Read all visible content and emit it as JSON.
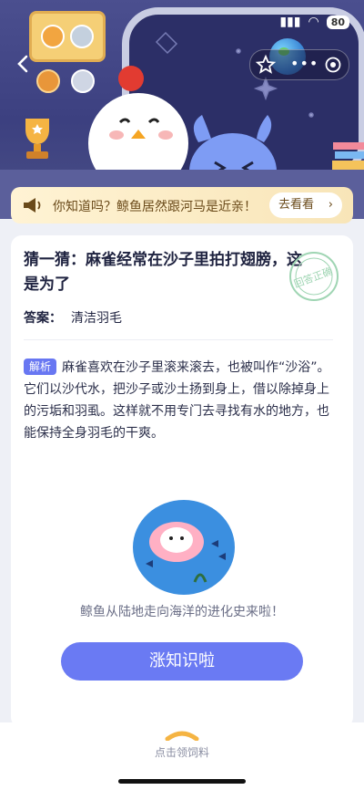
{
  "status_bar": {
    "battery": "80"
  },
  "notice": {
    "text": "你知道吗？鲸鱼居然跟河马是近亲！",
    "button_label": "去看看",
    "button_chevron": "›"
  },
  "question": {
    "title": "猜一猜：麻雀经常在沙子里拍打翅膀，这是为了",
    "stamp_text": "回答正确"
  },
  "answer": {
    "label": "答案：",
    "value": "清洁羽毛"
  },
  "analysis": {
    "tag": "解析",
    "text": "麻雀喜欢在沙子里滚来滚去，也被叫作“沙浴”。它们以沙代水，把沙子或沙土扬到身上，借以除掉身上的污垢和羽虱。这样就不用专门去寻找有水的地方，也能保持全身羽毛的干爽。"
  },
  "promo": {
    "caption": "鲸鱼从陆地走向海洋的进化史来啦！",
    "cta_label": "涨知识啦"
  },
  "bottom_bar": {
    "label": "点击领饲料"
  },
  "colors": {
    "accent": "#6a7af3",
    "hero_bg": "#3c4080",
    "notice_bg": "#fff3d4"
  },
  "icons": [
    "back-chevron-icon",
    "star-icon",
    "more-icon",
    "target-icon",
    "horn-icon",
    "handle-icon"
  ]
}
